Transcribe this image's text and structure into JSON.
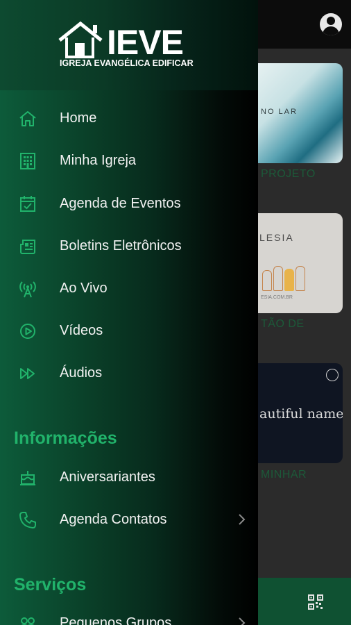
{
  "topbar": {
    "account_icon": "account-circle-icon"
  },
  "background_cards": [
    {
      "text": "NO LAR",
      "caption": "PROJETO"
    },
    {
      "text": "LESIA",
      "url": "ESIA.COM.BR",
      "caption": "TÃO DE"
    },
    {
      "text": "autiful name",
      "caption": "MINHAR"
    }
  ],
  "bottombar": {
    "qr_icon": "qr-code-icon"
  },
  "drawer": {
    "logo": {
      "word": "IEVE",
      "subtitle": "IGREJA EVANGÉLICA EDIFICAR"
    },
    "menu": [
      {
        "label": "Home",
        "icon": "home-icon"
      },
      {
        "label": "Minha Igreja",
        "icon": "building-icon"
      },
      {
        "label": "Agenda de Eventos",
        "icon": "calendar-check-icon"
      },
      {
        "label": "Boletins Eletrônicos",
        "icon": "newspaper-icon"
      },
      {
        "label": "Ao Vivo",
        "icon": "broadcast-tower-icon"
      },
      {
        "label": "Vídeos",
        "icon": "play-circle-icon"
      },
      {
        "label": "Áudios",
        "icon": "fast-forward-icon"
      }
    ],
    "sections": [
      {
        "title": "Informações",
        "items": [
          {
            "label": "Aniversariantes",
            "icon": "cake-icon"
          },
          {
            "label": "Agenda Contatos",
            "icon": "phone-icon",
            "has_submenu": true
          }
        ]
      },
      {
        "title": "Serviços",
        "items": [
          {
            "label": "Pequenos Grupos",
            "icon": "group-icon",
            "has_submenu": true
          }
        ]
      }
    ]
  },
  "colors": {
    "accent": "#21b36b",
    "drawer_dark": "#000000",
    "bottom_bar": "#0f5132"
  }
}
